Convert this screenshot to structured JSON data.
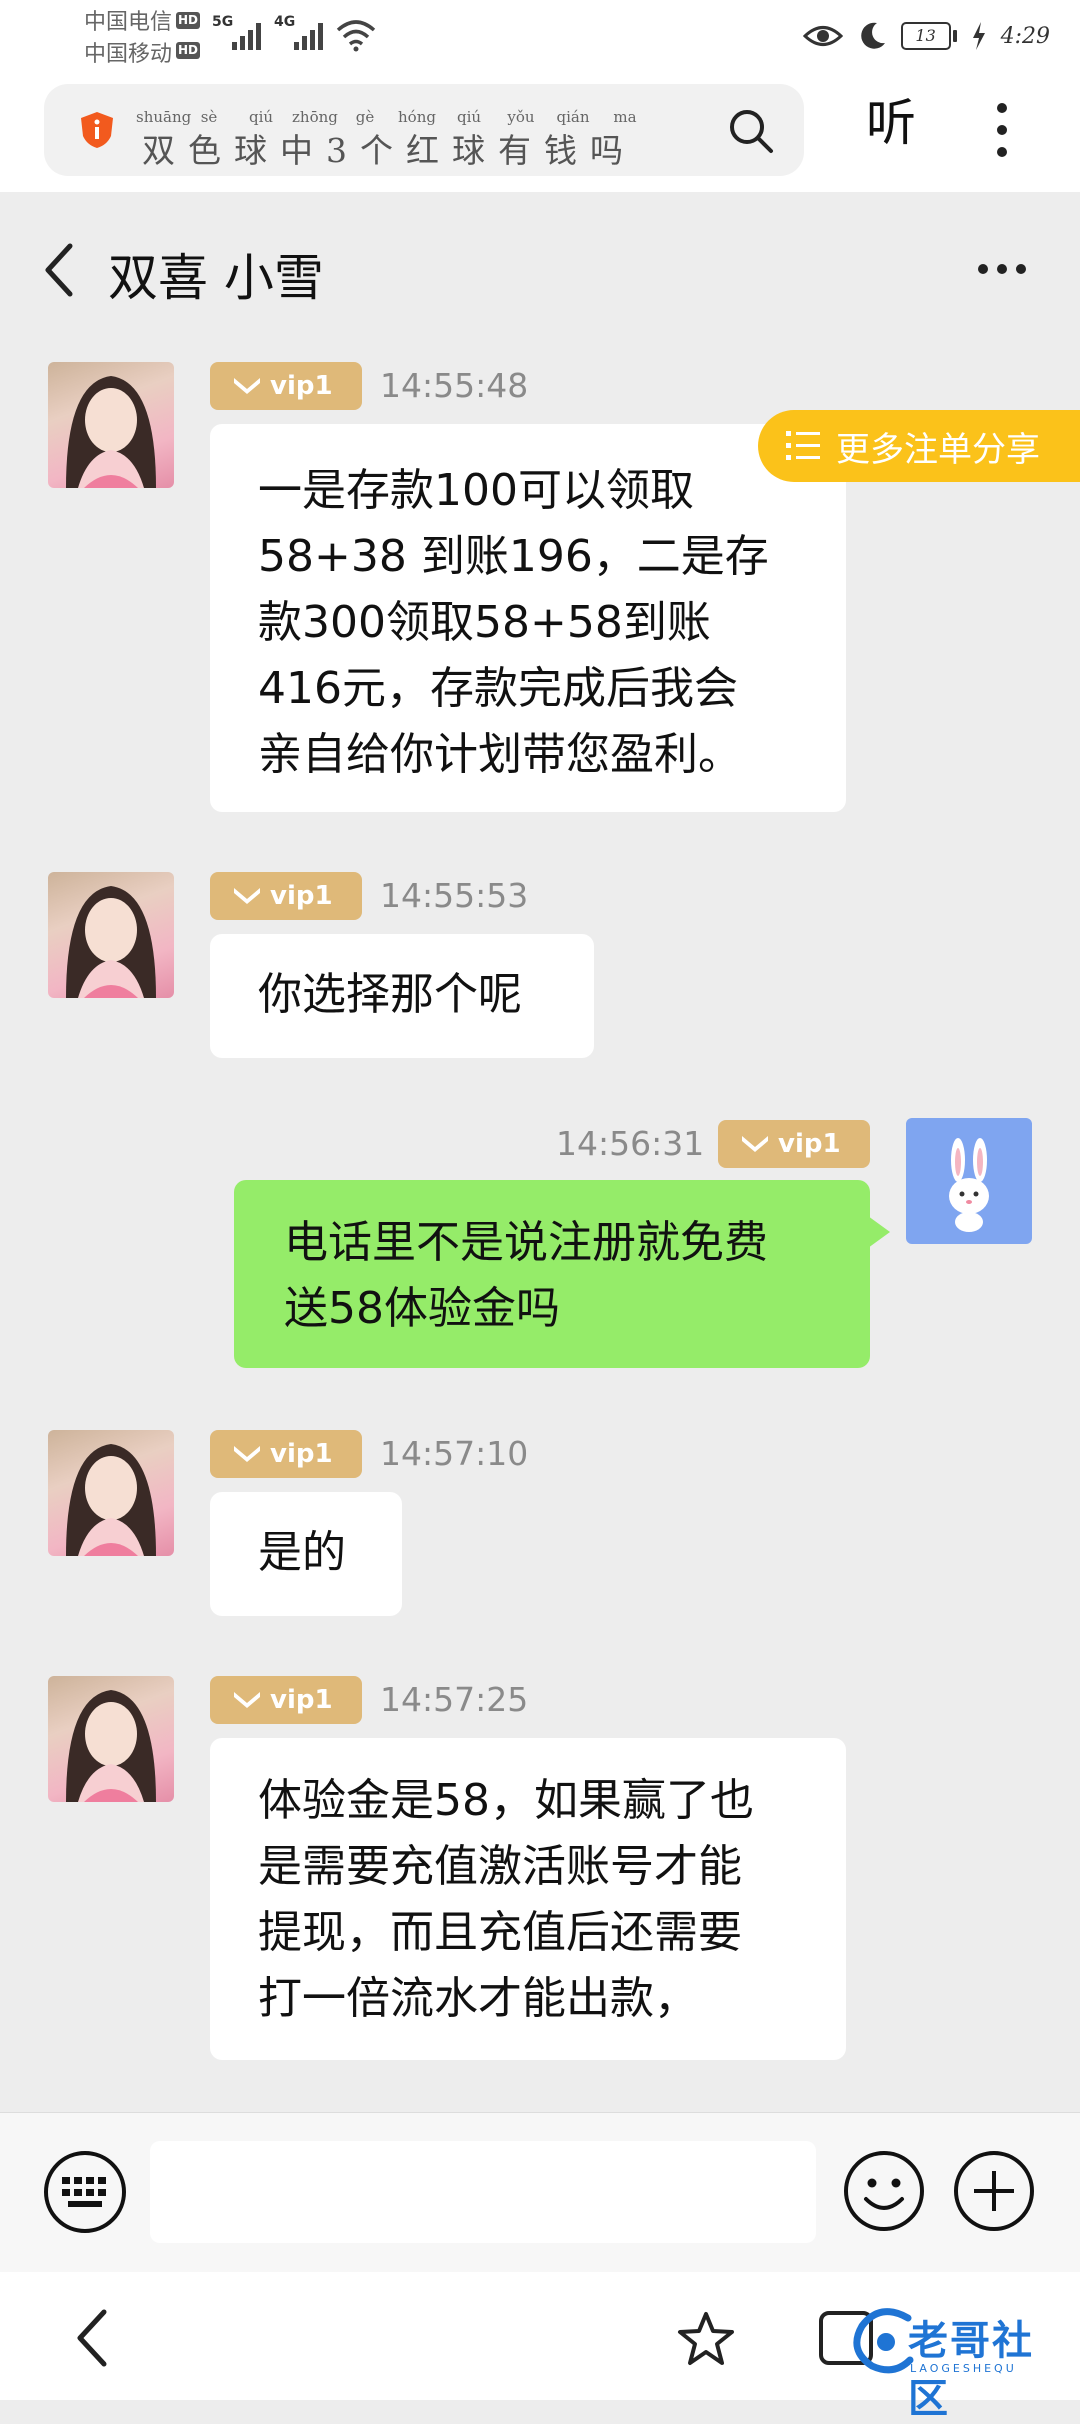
{
  "status_bar": {
    "carrier_1": "中国电信",
    "carrier_2": "中国移动",
    "hd": "HD",
    "net_1": "5G",
    "net_2": "4G",
    "battery": "13",
    "time": "4:29"
  },
  "search": {
    "pinyin": [
      "shuāng",
      "sè",
      "qiú",
      "zhōng",
      "gè",
      "hóng",
      "qiú",
      "yǒu",
      "qián",
      "ma"
    ],
    "query": "双色球中3个红球有钱吗",
    "listen_label": "听"
  },
  "chat": {
    "title": "双喜 小雪",
    "floating_tab_label": "更多注单分享",
    "messages": [
      {
        "badge": "vip1",
        "time": "14:55:48",
        "text": "一是存款100可以领取\n58+38 到账196，二是存\n款300领取58+58到账\n416元，存款完成后我会\n亲自给你计划带您盈利。"
      },
      {
        "badge": "vip1",
        "time": "14:55:53",
        "text": "你选择那个呢"
      },
      {
        "badge": "vip1",
        "time": "14:56:31",
        "text": "电话里不是说注册就免费\n送58体验金吗"
      },
      {
        "badge": "vip1",
        "time": "14:57:10",
        "text": "是的"
      },
      {
        "badge": "vip1",
        "time": "14:57:25",
        "text": "体验金是58，如果赢了也\n是需要充值激活账号才能\n提现，而且充值后还需要\n打一倍流水才能出款，"
      }
    ]
  },
  "watermark": {
    "text": "老哥社区",
    "sub": "LAOGESHEQU"
  },
  "colors": {
    "accent_green": "#95ec69",
    "vip_gold": "#dfb979",
    "tab_yellow": "#fbc21a",
    "background": "#ededed"
  }
}
